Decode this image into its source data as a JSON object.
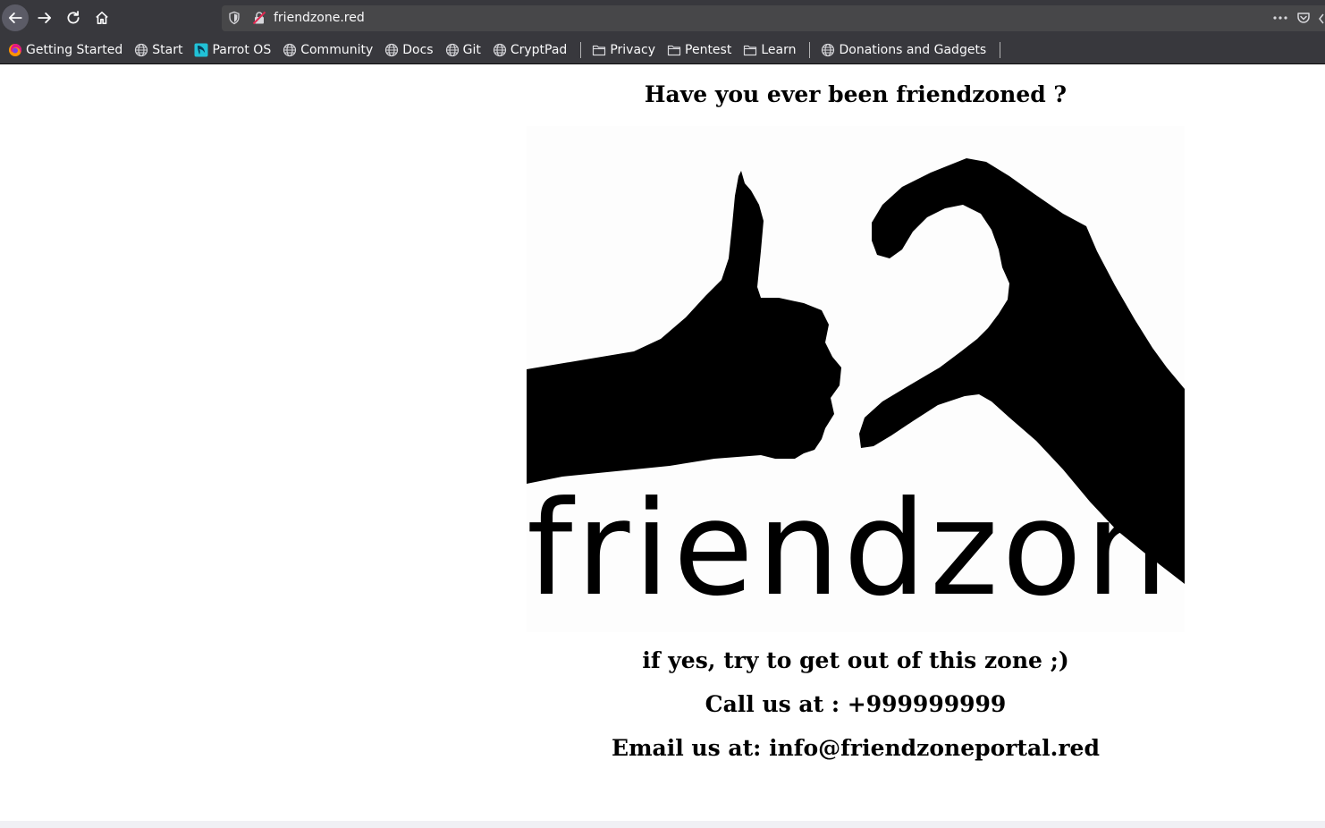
{
  "browser": {
    "url": "friendzone.red",
    "bookmarks": [
      {
        "label": "Getting Started",
        "icon": "firefox-icon"
      },
      {
        "label": "Start",
        "icon": "globe-icon"
      },
      {
        "label": "Parrot OS",
        "icon": "parrot-icon"
      },
      {
        "label": "Community",
        "icon": "globe-icon"
      },
      {
        "label": "Docs",
        "icon": "globe-icon"
      },
      {
        "label": "Git",
        "icon": "globe-icon"
      },
      {
        "label": "CryptPad",
        "icon": "globe-icon"
      },
      {
        "label": "Privacy",
        "icon": "folder-icon"
      },
      {
        "label": "Pentest",
        "icon": "folder-icon"
      },
      {
        "label": "Learn",
        "icon": "folder-icon"
      },
      {
        "label": "Donations and Gadgets",
        "icon": "globe-icon"
      }
    ]
  },
  "page": {
    "title": "Have you ever been friendzoned ?",
    "image_word": "friendzone",
    "line_yes": "if yes, try to get out of this zone ;)",
    "line_call": "Call us at : +999999999",
    "line_email": "Email us at: info@friendzoneportal.red"
  },
  "colors": {
    "chrome": "#38383d",
    "url_field": "#474749",
    "chrome_text": "#f9f9fa",
    "page_bg": "#ffffff",
    "text": "#000000"
  }
}
